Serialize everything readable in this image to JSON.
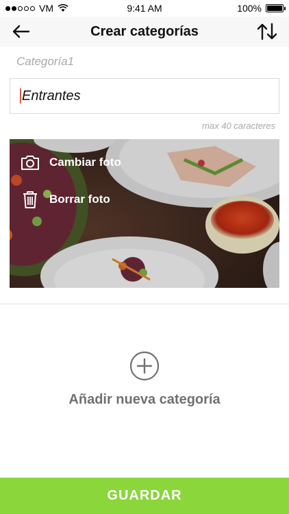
{
  "status_bar": {
    "carrier": "VM",
    "time": "9:41 AM",
    "battery": "100%",
    "battery_level": 1.0
  },
  "nav": {
    "title": "Crear categorías",
    "back_icon": "arrow-left-icon",
    "sort_icon": "sort-arrows-icon"
  },
  "form": {
    "category_label": "Categoría1",
    "name_value": "Entrantes",
    "max_hint": "max 40 caracteres"
  },
  "photo": {
    "change_label": "Cambiar foto",
    "delete_label": "Borrar foto",
    "change_icon": "camera-icon",
    "delete_icon": "trash-icon"
  },
  "add_category": {
    "label": "Añadir nueva categoría",
    "icon": "plus-circle-icon"
  },
  "footer": {
    "save_label": "GUARDAR",
    "accent_color": "#8ad63b"
  }
}
